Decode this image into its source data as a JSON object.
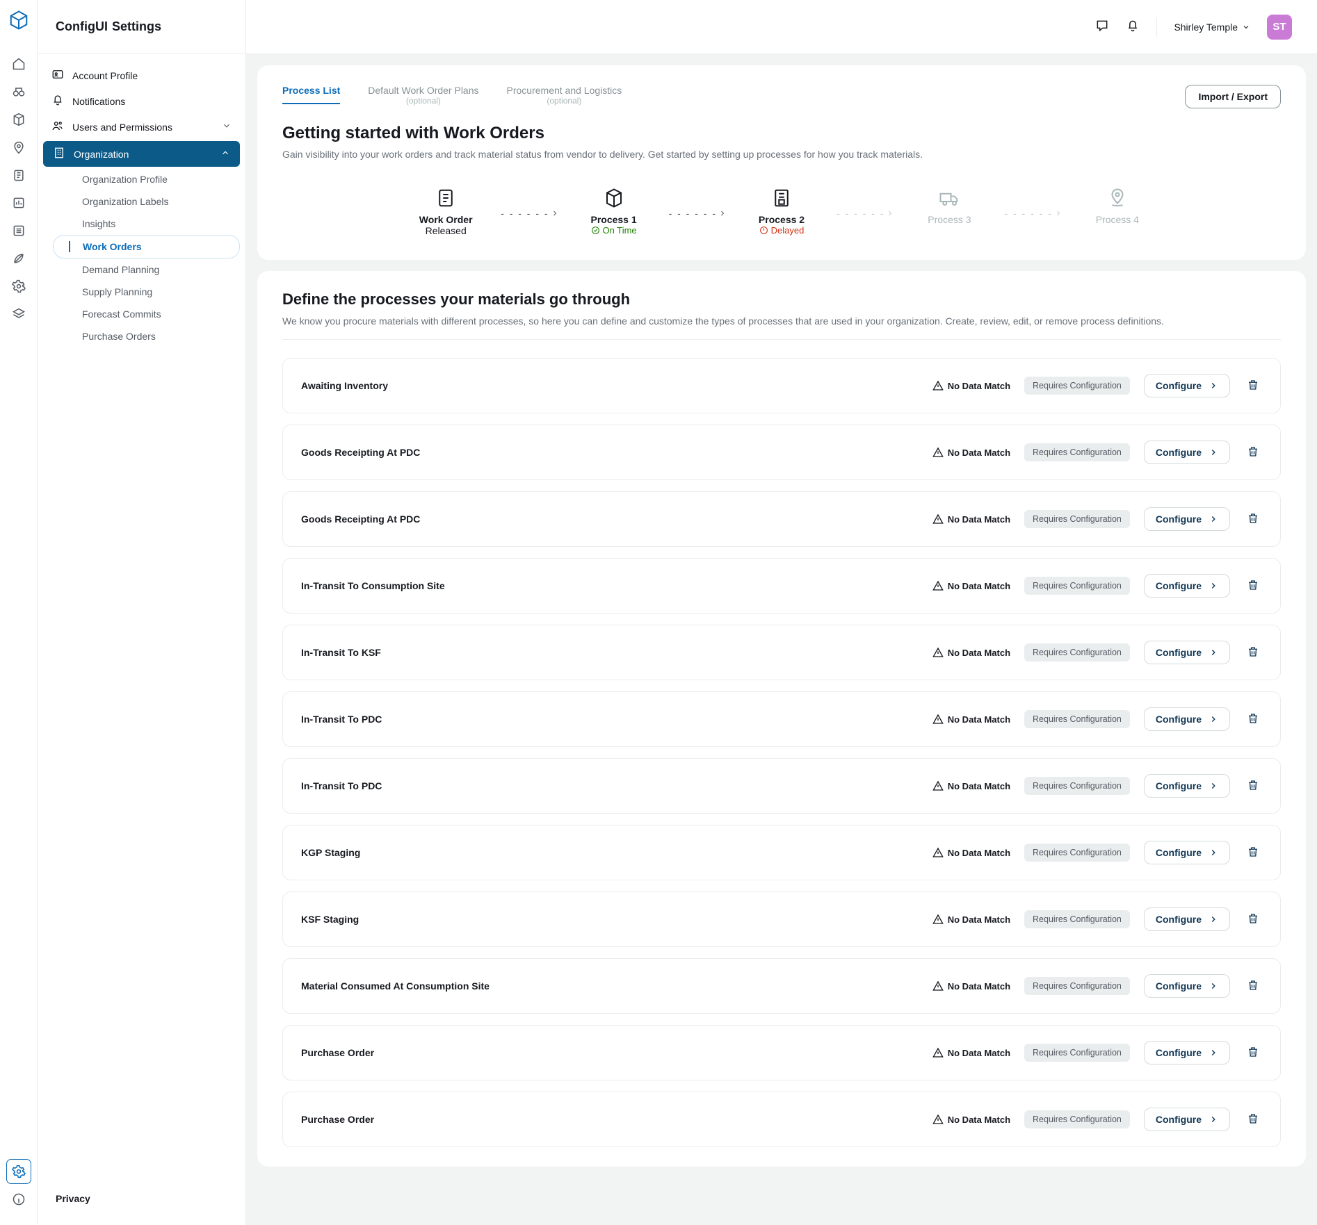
{
  "app": {
    "prefix": "ConfigUI",
    "title": "Settings"
  },
  "user": {
    "name": "Shirley Temple",
    "initials": "ST"
  },
  "sidebar": {
    "items": [
      {
        "label": "Account Profile"
      },
      {
        "label": "Notifications"
      },
      {
        "label": "Users and Permissions",
        "chevron": "down"
      },
      {
        "label": "Organization",
        "expanded": true,
        "chevron": "up"
      }
    ],
    "organization_submenu": [
      {
        "label": "Organization Profile"
      },
      {
        "label": "Organization Labels"
      },
      {
        "label": "Insights"
      },
      {
        "label": "Work Orders",
        "selected": true
      },
      {
        "label": "Demand Planning"
      },
      {
        "label": "Supply Planning"
      },
      {
        "label": "Forecast Commits"
      },
      {
        "label": "Purchase Orders"
      }
    ],
    "footer": "Privacy"
  },
  "tabs": [
    {
      "label": "Process List",
      "active": true
    },
    {
      "label": "Default Work Order Plans",
      "sub": "(optional)"
    },
    {
      "label": "Procurement and Logistics",
      "sub": "(optional)"
    }
  ],
  "import_export": "Import / Export",
  "hero": {
    "title": "Getting started with Work Orders",
    "subtitle": "Gain visibility into your work orders and track material status from vendor to delivery. Get started by setting up processes for how you track materials."
  },
  "stepper": [
    {
      "line1": "Work Order",
      "line2": "Released"
    },
    {
      "line1": "Process 1",
      "status": "on_time",
      "status_label": "On Time"
    },
    {
      "line1": "Process 2",
      "status": "delayed",
      "status_label": "Delayed"
    },
    {
      "line1": "Process 3",
      "future": true
    },
    {
      "line1": "Process 4",
      "future": true
    }
  ],
  "define": {
    "title": "Define the processes your materials go through",
    "subtitle": "We know you procure materials with different processes, so here you can define and customize the types of processes that are used in your organization. Create, review, edit, or remove process definitions."
  },
  "labels": {
    "no_data_match": "No Data Match",
    "requires_config": "Requires Configuration",
    "configure": "Configure"
  },
  "processes": [
    {
      "name": "Awaiting Inventory"
    },
    {
      "name": "Goods Receipting At PDC"
    },
    {
      "name": "Goods Receipting At PDC"
    },
    {
      "name": "In-Transit To Consumption Site"
    },
    {
      "name": "In-Transit To KSF"
    },
    {
      "name": "In-Transit To PDC"
    },
    {
      "name": "In-Transit To PDC"
    },
    {
      "name": "KGP Staging"
    },
    {
      "name": "KSF Staging"
    },
    {
      "name": "Material Consumed At Consumption Site"
    },
    {
      "name": "Purchase Order"
    },
    {
      "name": "Purchase Order"
    }
  ]
}
